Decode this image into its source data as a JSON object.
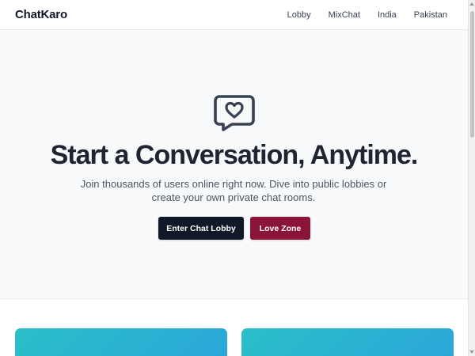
{
  "navbar": {
    "brand": "ChatKaro",
    "links": [
      "Lobby",
      "MixChat",
      "India",
      "Pakistan"
    ]
  },
  "hero": {
    "icon": "chat-heart-icon",
    "title": "Start a Conversation, Anytime.",
    "subtitle": "Join thousands of users online right now. Dive into public lobbies or create your own private chat rooms.",
    "primary_button": "Enter Chat Lobby",
    "secondary_button": "Love Zone"
  },
  "colors": {
    "primary_button": "#111827",
    "love_button": "#8b1538",
    "card_gradient_start": "#2bbfc8",
    "card_gradient_end": "#2aa6d8",
    "hero_background": "#f8f9fb"
  }
}
